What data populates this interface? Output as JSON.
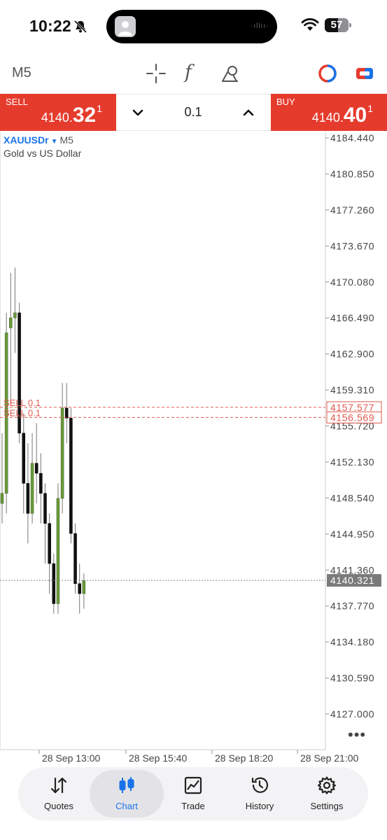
{
  "status_bar": {
    "time": "10:22",
    "battery_level": "57",
    "icons": [
      "bell-slash-icon",
      "wifi-icon",
      "battery-icon"
    ]
  },
  "toolbar": {
    "timeframe": "M5",
    "icons": [
      "crosshair-icon",
      "indicators-f-icon",
      "objects-icon",
      "mode-toggle-icon",
      "ticket-icon"
    ]
  },
  "trade": {
    "sell": {
      "label": "SELL",
      "price_small": "4140.",
      "price_big": "32",
      "price_sup": "1"
    },
    "buy": {
      "label": "BUY",
      "price_small": "4140.",
      "price_big": "40",
      "price_sup": "1"
    },
    "volume": "0.1"
  },
  "chart": {
    "symbol": "XAUUSDr",
    "symbol_timeframe": "M5",
    "description": "Gold vs US Dollar",
    "price_axis": [
      "4184.440",
      "4180.850",
      "4177.260",
      "4173.670",
      "4170.080",
      "4166.490",
      "4162.900",
      "4159.310",
      "4155.720",
      "4152.130",
      "4148.540",
      "4144.950",
      "4141.360",
      "4137.770",
      "4134.180",
      "4130.590",
      "4127.000"
    ],
    "time_axis": [
      "28 Sep 13:00",
      "28 Sep 15:40",
      "28 Sep 18:20",
      "28 Sep 21:00"
    ],
    "current_price": "4140.321",
    "orders": [
      {
        "label": "SELL 0.1",
        "price": "4157.577"
      },
      {
        "label": "SELL 0.1",
        "price": "4156.569"
      }
    ],
    "colors": {
      "bull": "#6a9a3c",
      "bear": "#111111",
      "order_line": "#e05a4e",
      "grid": "#cccccc"
    }
  },
  "chart_data": {
    "type": "candlestick",
    "title": "Gold vs US Dollar",
    "ylim": [
      4127.0,
      4184.44
    ],
    "series": [
      {
        "name": "XAUUSDr",
        "candles": [
          {
            "o": 4148.0,
            "h": 4155.0,
            "l": 4146.0,
            "c": 4149.0
          },
          {
            "o": 4149.0,
            "h": 4167.0,
            "l": 4147.0,
            "c": 4165.0
          },
          {
            "o": 4165.5,
            "h": 4171.0,
            "l": 4158.0,
            "c": 4166.5
          },
          {
            "o": 4166.5,
            "h": 4171.5,
            "l": 4163.0,
            "c": 4167.0
          },
          {
            "o": 4167.0,
            "h": 4168.0,
            "l": 4154.0,
            "c": 4155.0
          },
          {
            "o": 4155.0,
            "h": 4157.0,
            "l": 4147.0,
            "c": 4150.0
          },
          {
            "o": 4150.0,
            "h": 4154.0,
            "l": 4144.0,
            "c": 4147.0
          },
          {
            "o": 4147.0,
            "h": 4155.0,
            "l": 4146.0,
            "c": 4152.0
          },
          {
            "o": 4152.0,
            "h": 4156.0,
            "l": 4148.0,
            "c": 4151.0
          },
          {
            "o": 4151.0,
            "h": 4153.0,
            "l": 4146.0,
            "c": 4149.0
          },
          {
            "o": 4149.0,
            "h": 4150.0,
            "l": 4142.0,
            "c": 4146.0
          },
          {
            "o": 4146.0,
            "h": 4147.0,
            "l": 4139.0,
            "c": 4142.0
          },
          {
            "o": 4142.0,
            "h": 4143.0,
            "l": 4137.0,
            "c": 4138.0
          },
          {
            "o": 4138.0,
            "h": 4150.0,
            "l": 4137.0,
            "c": 4148.5
          },
          {
            "o": 4148.5,
            "h": 4160.0,
            "l": 4147.0,
            "c": 4157.5
          },
          {
            "o": 4157.5,
            "h": 4160.0,
            "l": 4154.0,
            "c": 4156.5
          },
          {
            "o": 4156.5,
            "h": 4157.5,
            "l": 4144.0,
            "c": 4145.0
          },
          {
            "o": 4145.0,
            "h": 4146.0,
            "l": 4139.0,
            "c": 4140.0
          },
          {
            "o": 4140.0,
            "h": 4142.0,
            "l": 4137.0,
            "c": 4139.0
          },
          {
            "o": 4139.0,
            "h": 4141.0,
            "l": 4137.5,
            "c": 4140.3
          }
        ]
      }
    ],
    "hlines": [
      {
        "label": "SELL 0.1",
        "value": 4157.577
      },
      {
        "label": "SELL 0.1",
        "value": 4156.569
      },
      {
        "label": "current",
        "value": 4140.321
      }
    ]
  },
  "nav": {
    "items": [
      {
        "label": "Quotes",
        "icon": "quotes-arrows-icon"
      },
      {
        "label": "Chart",
        "icon": "candles-icon"
      },
      {
        "label": "Trade",
        "icon": "trade-chart-icon"
      },
      {
        "label": "History",
        "icon": "history-clock-icon"
      },
      {
        "label": "Settings",
        "icon": "gear-icon"
      }
    ],
    "active": "Chart"
  }
}
